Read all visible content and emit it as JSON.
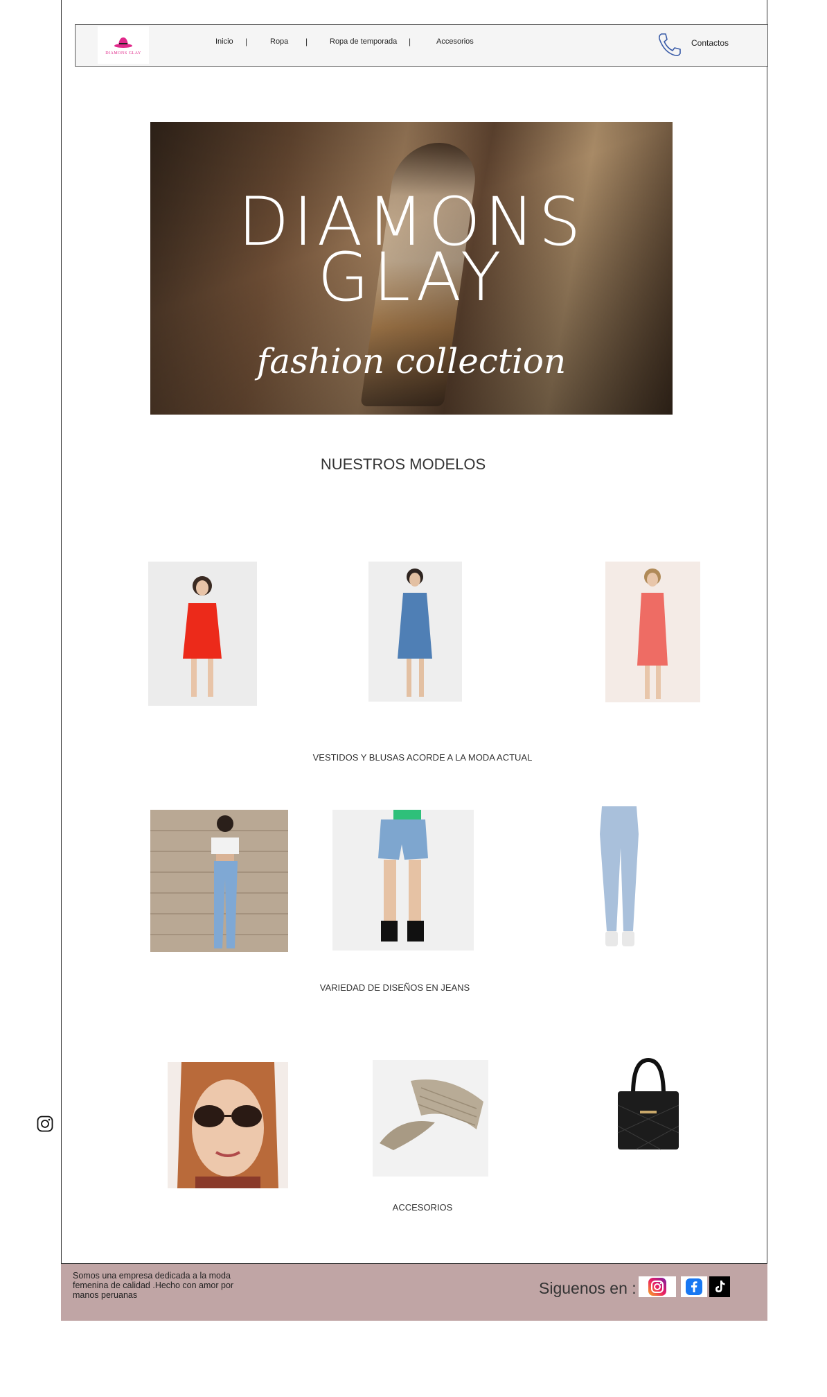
{
  "nav": {
    "logo_text": "DIAMONS GLAY",
    "items": [
      "Inicio",
      "Ropa",
      "Ropa de temporada",
      "Accesorios"
    ],
    "separator": "|",
    "contact_label": "Contactos"
  },
  "hero": {
    "line1": "DIAMONS",
    "line2": "GLAY",
    "subtitle": "fashion collection"
  },
  "main": {
    "section_title": "NUESTROS MODELOS",
    "dresses_caption": "VESTIDOS Y BLUSAS ACORDE A LA MODA ACTUAL",
    "jeans_caption": "VARIEDAD DE DISEÑOS EN JEANS",
    "accessories_caption": "ACCESORIOS"
  },
  "footer": {
    "about": "Somos una empresa dedicada a la moda femenina de calidad .Hecho  con amor por manos peruanas",
    "follow_label": "Siguenos en :"
  },
  "colors": {
    "footer_bg": "#c0a5a5",
    "nav_bg": "#f5f5f5",
    "brand_pink": "#e0288a",
    "phone_blue": "#3a5ca8"
  },
  "icons": [
    "phone-icon",
    "instagram-icon",
    "facebook-icon",
    "tiktok-icon"
  ]
}
